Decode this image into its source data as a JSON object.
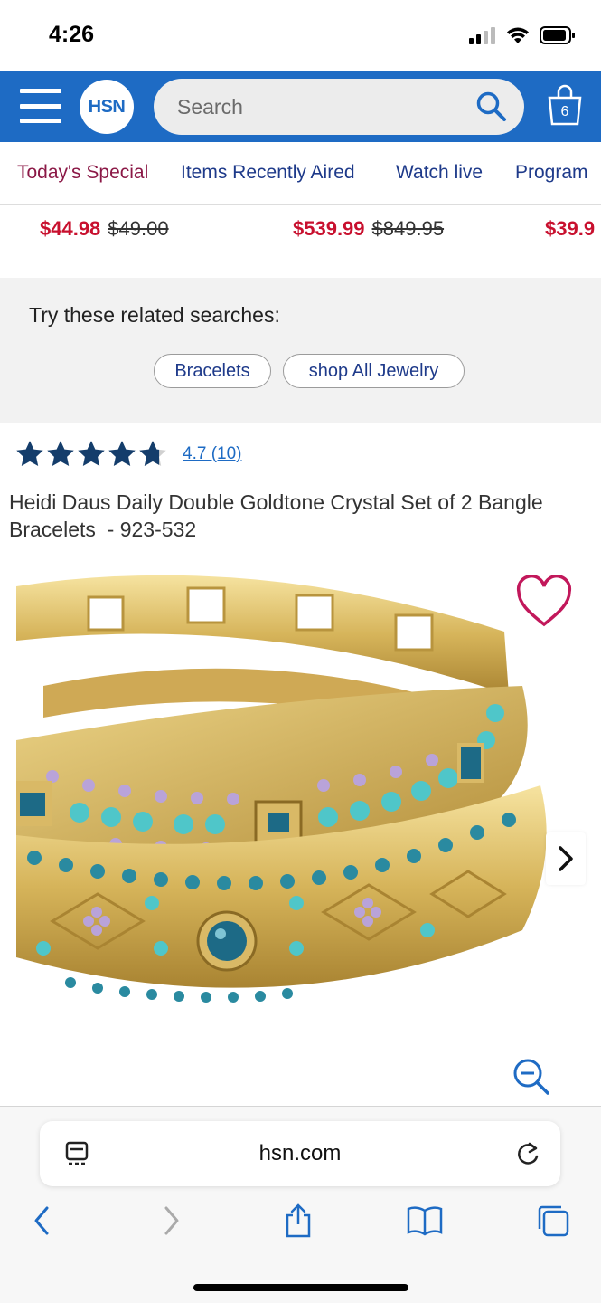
{
  "status": {
    "time": "4:26"
  },
  "header": {
    "logo_text": "HSN",
    "search_placeholder": "Search",
    "bag_count": "6",
    "brand_color": "#1e6bc4"
  },
  "nav": {
    "tabs": [
      {
        "label": "Today's Special"
      },
      {
        "label": "Items Recently Aired"
      },
      {
        "label": "Watch live"
      },
      {
        "label": "Program"
      }
    ]
  },
  "prices": [
    {
      "sale": "$44.98",
      "original": "$49.00"
    },
    {
      "sale": "$539.99",
      "original": "$849.95"
    },
    {
      "sale": "$39.9",
      "original": ""
    }
  ],
  "related": {
    "title": "Try these related searches:",
    "chips": [
      {
        "label": "Bracelets"
      },
      {
        "label": "shop All Jewelry"
      }
    ]
  },
  "product": {
    "rating_text": "4.7 (10)",
    "rating_value": 4.7,
    "title": "Heidi Daus Daily Double Goldtone Crystal Set of 2 Bangle Bracelets  - 923-532"
  },
  "browser": {
    "url": "hsn.com"
  }
}
